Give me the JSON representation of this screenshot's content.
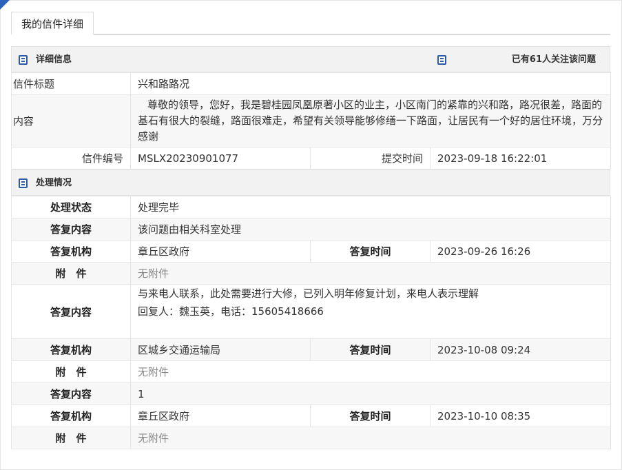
{
  "page": {
    "tab_title": "我的信件详细"
  },
  "detail": {
    "section_title": "详细信息",
    "follow_text": "已有61人关注该问题",
    "rows": {
      "subject_label": "信件标题",
      "subject_value": "兴和路路况",
      "content_label": "内容",
      "content_value": "尊敬的领导，您好，我是碧桂园凤凰原著小区的业主，小区南门的紧靠的兴和路，路况很差，路面的基石有很大的裂缝，路面很难走，希望有关领导能够修缮一下路面，让居民有一个好的居住环境，万分感谢",
      "number_label": "信件编号",
      "number_value": "MSLX20230901077",
      "submit_label": "提交时间",
      "submit_value": "2023-09-18 16:22:01"
    }
  },
  "handling": {
    "section_title": "处理情况",
    "status_label": "处理状态",
    "status_value": "处理完毕",
    "replies": [
      {
        "content_label": "答复内容",
        "content_value": "该问题由相关科室处理",
        "org_label": "答复机构",
        "org_value": "章丘区政府",
        "time_label": "答复时间",
        "time_value": "2023-09-26 16:26",
        "attach_label": "附　件",
        "attach_value": "无附件"
      },
      {
        "content_label": "答复内容",
        "content_line1": "与来电人联系，此处需要进行大修，已列入明年修复计划，来电人表示理解",
        "content_line2": "回复人：魏玉英，电话：15605418666",
        "org_label": "答复机构",
        "org_value": "区城乡交通运输局",
        "time_label": "答复时间",
        "time_value": "2023-10-08 09:24",
        "attach_label": "附　件",
        "attach_value": "无附件"
      },
      {
        "content_label": "答复内容",
        "content_value": "1",
        "org_label": "答复机构",
        "org_value": "章丘区政府",
        "time_label": "答复时间",
        "time_value": "2023-10-10 08:35",
        "attach_label": "附　件",
        "attach_value": "无附件"
      }
    ]
  },
  "icons": {
    "section_icon": "document-icon"
  },
  "colors": {
    "accent": "#2b63ba",
    "header_bg": "#f2f2f2",
    "zebra_bg": "#f7f7f7",
    "muted_text": "#888888"
  }
}
